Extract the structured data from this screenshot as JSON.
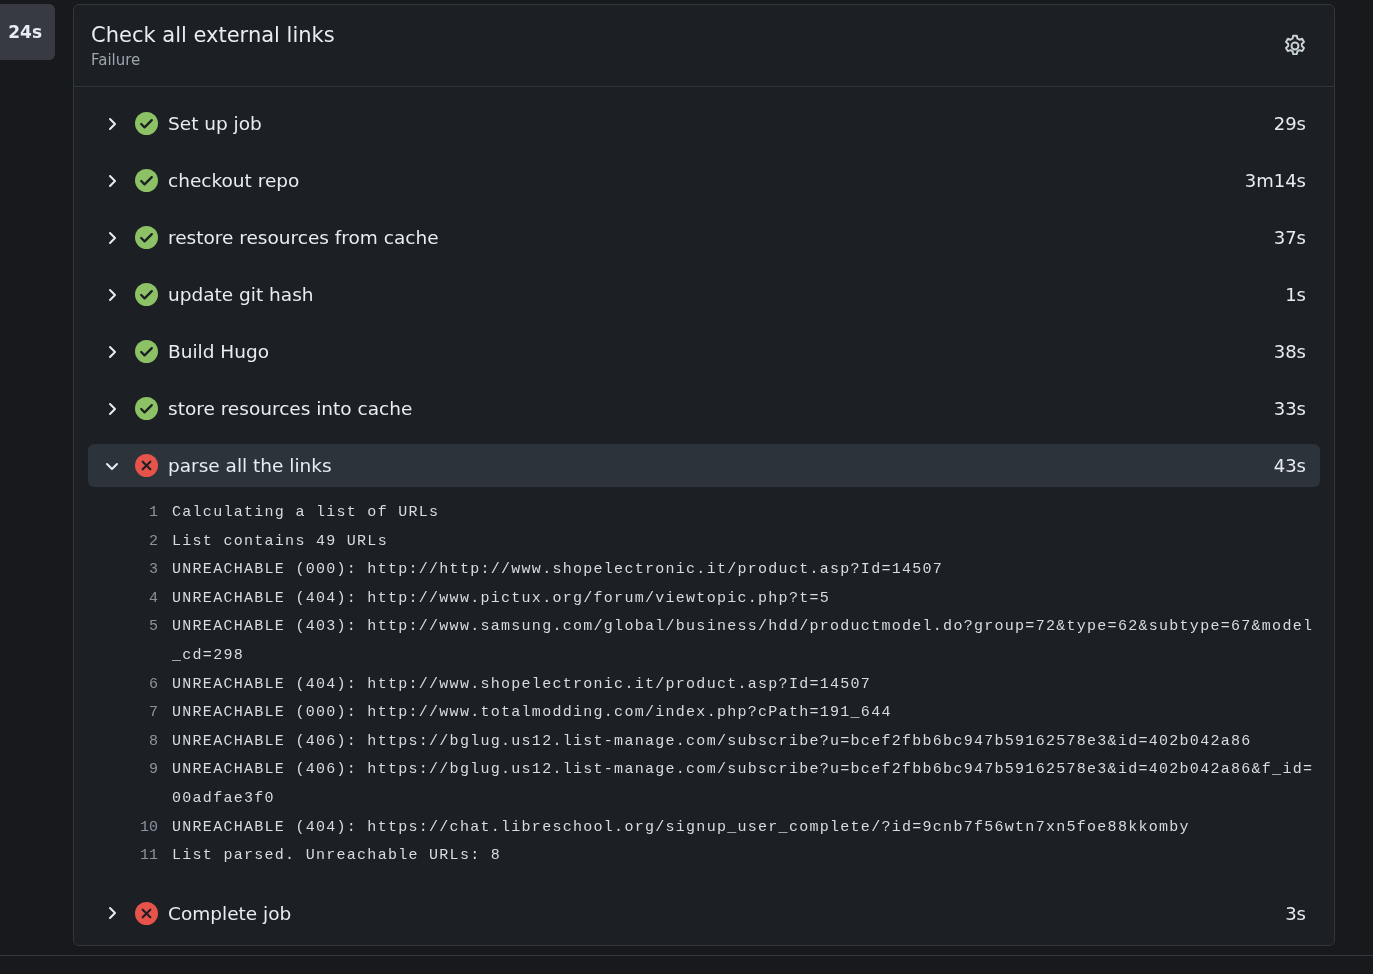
{
  "sidebar_tab": {
    "label": "24s"
  },
  "job": {
    "title": "Check all external links",
    "status": "Failure"
  },
  "steps": [
    {
      "name": "Set up job",
      "failed": false,
      "expanded": false,
      "duration": "29s"
    },
    {
      "name": "checkout repo",
      "failed": false,
      "expanded": false,
      "duration": "3m14s"
    },
    {
      "name": "restore resources from cache",
      "failed": false,
      "expanded": false,
      "duration": "37s"
    },
    {
      "name": "update git hash",
      "failed": false,
      "expanded": false,
      "duration": "1s"
    },
    {
      "name": "Build Hugo",
      "failed": false,
      "expanded": false,
      "duration": "38s"
    },
    {
      "name": "store resources into cache",
      "failed": false,
      "expanded": false,
      "duration": "33s"
    },
    {
      "name": "parse all the links",
      "failed": true,
      "expanded": true,
      "duration": "43s",
      "log": [
        {
          "number": "1",
          "text": "Calculating a list of URLs"
        },
        {
          "number": "2",
          "text": "List contains 49 URLs"
        },
        {
          "number": "3",
          "text": "UNREACHABLE (000): http://http://www.shopelectronic.it/product.asp?Id=14507"
        },
        {
          "number": "4",
          "text": "UNREACHABLE (404): http://www.pictux.org/forum/viewtopic.php?t=5"
        },
        {
          "number": "5",
          "text": "UNREACHABLE (403): http://www.samsung.com/global/business/hdd/productmodel.do?group=72&type=62&subtype=67&model_cd=298"
        },
        {
          "number": "6",
          "text": "UNREACHABLE (404): http://www.shopelectronic.it/product.asp?Id=14507"
        },
        {
          "number": "7",
          "text": "UNREACHABLE (000): http://www.totalmodding.com/index.php?cPath=191_644"
        },
        {
          "number": "8",
          "text": "UNREACHABLE (406): https://bglug.us12.list-manage.com/subscribe?u=bcef2fbb6bc947b59162578e3&id=402b042a86"
        },
        {
          "number": "9",
          "text": "UNREACHABLE (406): https://bglug.us12.list-manage.com/subscribe?u=bcef2fbb6bc947b59162578e3&id=402b042a86&f_id=00adfae3f0"
        },
        {
          "number": "10",
          "text": "UNREACHABLE (404): https://chat.libreschool.org/signup_user_complete/?id=9cnb7f56wtn7xn5foe88kkomby"
        },
        {
          "number": "11",
          "text": "List parsed. Unreachable URLs: 8"
        }
      ]
    },
    {
      "name": "Complete job",
      "failed": true,
      "expanded": false,
      "duration": "3s"
    }
  ]
}
